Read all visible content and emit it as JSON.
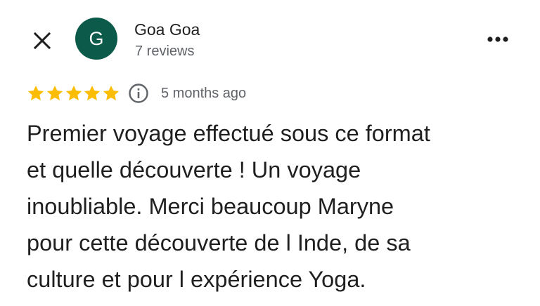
{
  "header": {
    "close_icon": "close-icon",
    "more_icon": "more-vertical-dots-icon"
  },
  "reviewer": {
    "initial": "G",
    "name": "Goa Goa",
    "meta": "7 reviews",
    "avatar_color": "#0b5a4a"
  },
  "rating": {
    "stars": 5,
    "max_stars": 5,
    "star_color": "#fbbc04",
    "info_icon": "info-icon",
    "time": "5 months ago"
  },
  "review": {
    "lines": [
      "Premier voyage effectué sous ce format",
      "et quelle découverte ! Un voyage",
      "inoubliable. Merci beaucoup Maryne",
      "pour cette découverte de l Inde, de sa",
      "culture et pour l expérience Yoga."
    ]
  }
}
